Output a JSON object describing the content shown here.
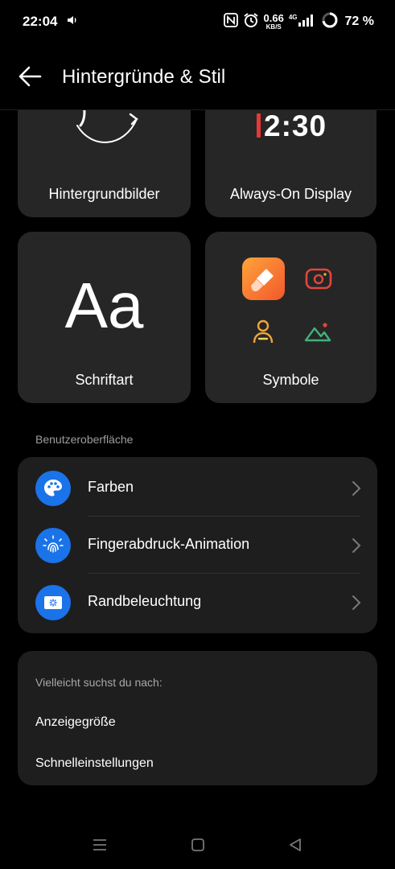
{
  "status_bar": {
    "time": "22:04",
    "speed_value": "0.66",
    "speed_unit": "KB/S",
    "network": "4G",
    "battery": "72 %"
  },
  "header": {
    "title": "Hintergründe & Stil"
  },
  "tiles": {
    "wallpapers": {
      "label": "Hintergrundbilder"
    },
    "always_on": {
      "label": "Always-On Display",
      "clock": "2:30",
      "accent": "#e53935"
    },
    "font": {
      "label": "Schriftart",
      "sample": "Aa"
    },
    "symbols": {
      "label": "Symbole"
    }
  },
  "ui_section": {
    "heading": "Benutzeroberfläche",
    "items": [
      {
        "label": "Farben",
        "icon": "palette-icon"
      },
      {
        "label": "Fingerabdruck-Animation",
        "icon": "fingerprint-icon"
      },
      {
        "label": "Randbeleuchtung",
        "icon": "edge-lighting-icon"
      }
    ],
    "icon_color": "#1a73e8"
  },
  "suggestions": {
    "title": "Vielleicht suchst du nach:",
    "items": [
      "Anzeigegröße",
      "Schnelleinstellungen"
    ]
  }
}
